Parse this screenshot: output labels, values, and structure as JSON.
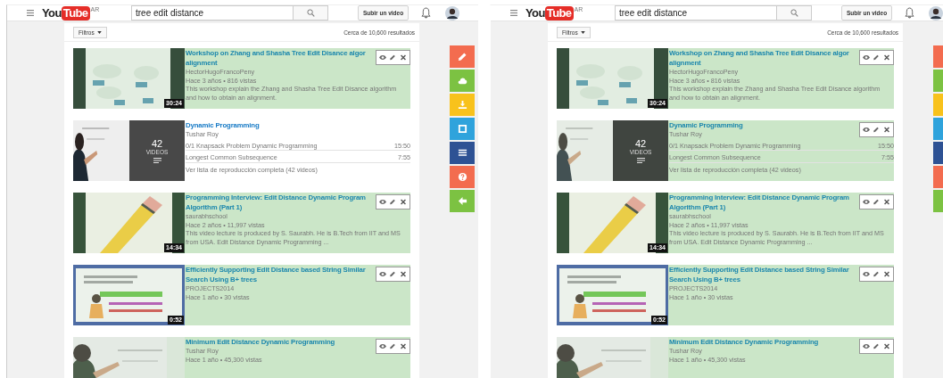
{
  "panels": [
    {
      "header": {
        "logo_you": "You",
        "logo_tube": "Tube",
        "region": "AR",
        "search_value": "tree edit distance",
        "upload_button": "Subir un video"
      },
      "filter_button": "Filtros",
      "results_count": "Cerca de 10,600 resultados",
      "results": [
        {
          "kind": "video",
          "highlighted": true,
          "title_lines": [
            "Workshop on Zhang and Shasha Tree Edit Disance algor",
            "alignment"
          ],
          "channel": "HectorHugoFrancoPeny",
          "meta": "Hace 3 años • 816 vistas",
          "description_lines": [
            "This workshop explain the Zhang and Shasha Tree Edit Disance algorithm",
            "and how to obtain an alignment."
          ],
          "duration": "30:24"
        },
        {
          "kind": "playlist",
          "highlighted": false,
          "title_lines": [
            "Dynamic Programming"
          ],
          "channel": "Tushar Roy",
          "video_count": "42",
          "video_count_label": "VIDEOS",
          "entries": [
            {
              "title": "0/1 Knapsack Problem Dynamic Programming",
              "duration": "15:50"
            },
            {
              "title": "Longest Common Subsequence",
              "duration": "7:55"
            }
          ],
          "full_list_link": "Ver lista de reproducción completa (42 videos)"
        },
        {
          "kind": "video",
          "highlighted": true,
          "title_lines": [
            "Programming Interview: Edit Distance Dynamic Program",
            "Algorithm (Part 1)"
          ],
          "channel": "saurabhschool",
          "meta": "Hace 2 años • 11,997 vistas",
          "description_lines": [
            "This video lecture is produced by S. Saurabh. He is B.Tech from IIT and MS",
            "from USA. Edit Distance Dynamic Programming ..."
          ],
          "duration": "14:34"
        },
        {
          "kind": "video",
          "highlighted": true,
          "title_lines": [
            "Efficiently Supporting Edit Distance based String Similar",
            "Search Using B+ trees"
          ],
          "channel": "PROJECTS2014",
          "meta": "Hace 1 año • 30 vistas",
          "duration": "0:52"
        },
        {
          "kind": "video",
          "highlighted": true,
          "title_lines": [
            "Minimum Edit Distance Dynamic Programming"
          ],
          "channel": "Tushar Roy",
          "meta": "Hace 1 año • 45,300 vistas"
        }
      ],
      "tool_buttons": [
        {
          "color": "#f36c4f"
        },
        {
          "color": "#7cc242"
        },
        {
          "color": "#f8c21c"
        },
        {
          "color": "#2fa3dc"
        },
        {
          "color": "#2e5294"
        },
        {
          "color": "#f36c4f"
        },
        {
          "color": "#7cc242"
        }
      ]
    },
    {
      "header": {
        "logo_you": "You",
        "logo_tube": "Tube",
        "region": "AR",
        "search_value": "tree edit distance",
        "upload_button": "Subir un video"
      },
      "filter_button": "Filtros",
      "results_count": "Cerca de 10,600 resultados",
      "results": [
        {
          "kind": "video",
          "highlighted": true,
          "title_lines": [
            "Workshop on Zhang and Shasha Tree Edit Disance algor",
            "alignment"
          ],
          "channel": "HectorHugoFrancoPeny",
          "meta": "Hace 3 años • 816 vistas",
          "description_lines": [
            "This workshop explain the Zhang and Shasha Tree Edit Disance algorithm",
            "and how to obtain an alignment."
          ],
          "duration": "30:24"
        },
        {
          "kind": "playlist",
          "highlighted": true,
          "title_lines": [
            "Dynamic Programming"
          ],
          "channel": "Tushar Roy",
          "video_count": "42",
          "video_count_label": "VIDEOS",
          "entries": [
            {
              "title": "0/1 Knapsack Problem Dynamic Programming",
              "duration": "15:50"
            },
            {
              "title": "Longest Common Subsequence",
              "duration": "7:55"
            }
          ],
          "full_list_link": "Ver lista de reproducción completa (42 videos)"
        },
        {
          "kind": "video",
          "highlighted": true,
          "title_lines": [
            "Programming Interview: Edit Distance Dynamic Program",
            "Algorithm (Part 1)"
          ],
          "channel": "saurabhschool",
          "meta": "Hace 2 años • 11,997 vistas",
          "description_lines": [
            "This video lecture is produced by S. Saurabh. He is B.Tech from IIT and MS",
            "from USA. Edit Distance Dynamic Programming ..."
          ],
          "duration": "14:34"
        },
        {
          "kind": "video",
          "highlighted": true,
          "title_lines": [
            "Efficiently Supporting Edit Distance based String Similar",
            "Search Using B+ trees"
          ],
          "channel": "PROJECTS2014",
          "meta": "Hace 1 año • 30 vistas",
          "duration": "0:52"
        },
        {
          "kind": "video",
          "highlighted": true,
          "title_lines": [
            "Minimum Edit Distance Dynamic Programming"
          ],
          "channel": "Tushar Roy",
          "meta": "Hace 1 año • 45,300 vistas"
        }
      ],
      "tool_buttons": [
        {
          "color": "#f36c4f"
        },
        {
          "color": "#7cc242"
        },
        {
          "color": "#f8c21c"
        },
        {
          "color": "#2fa3dc"
        },
        {
          "color": "#2e5294"
        },
        {
          "color": "#f36c4f"
        },
        {
          "color": "#7cc242"
        }
      ]
    }
  ]
}
